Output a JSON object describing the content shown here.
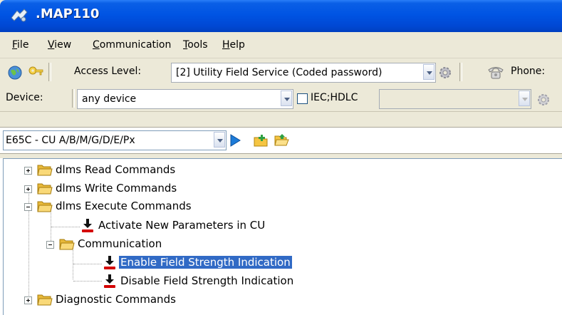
{
  "window": {
    "title": ".MAP110"
  },
  "menu": [
    {
      "label_u": "F",
      "label_rest": "ile"
    },
    {
      "label_u": "V",
      "label_rest": "iew"
    },
    {
      "label_u": "C",
      "label_rest": "ommunication"
    },
    {
      "label_u": "T",
      "label_rest": "ools"
    },
    {
      "label_u": "H",
      "label_rest": "elp"
    }
  ],
  "toolbar1": {
    "access_level_label": "Access Level:",
    "access_level_value": "[2] Utility Field Service (Coded password)",
    "phone_label": "Phone:"
  },
  "toolbar2": {
    "device_label": "Device:",
    "device_value": "any device",
    "protocol_label": "IEC;HDLC",
    "protocol_checked": false
  },
  "command_bar": {
    "meter_type": "E65C - CU A/B/M/G/D/E/Px"
  },
  "tree": {
    "items": [
      {
        "label": "dlms Read Commands"
      },
      {
        "label": "dlms Write Commands"
      },
      {
        "label": "dlms Execute Commands"
      },
      {
        "label": "Activate New Parameters in CU"
      },
      {
        "label": "Communication"
      },
      {
        "label": "Enable Field Strength Indication",
        "selected": true
      },
      {
        "label": "Disable Field Strength Indication"
      },
      {
        "label": "Diagnostic Commands"
      }
    ]
  },
  "colors": {
    "titlebar": "#0054e3",
    "selection": "#316ac5",
    "folder": "#f5c542",
    "command_arrow": "#d40000"
  }
}
